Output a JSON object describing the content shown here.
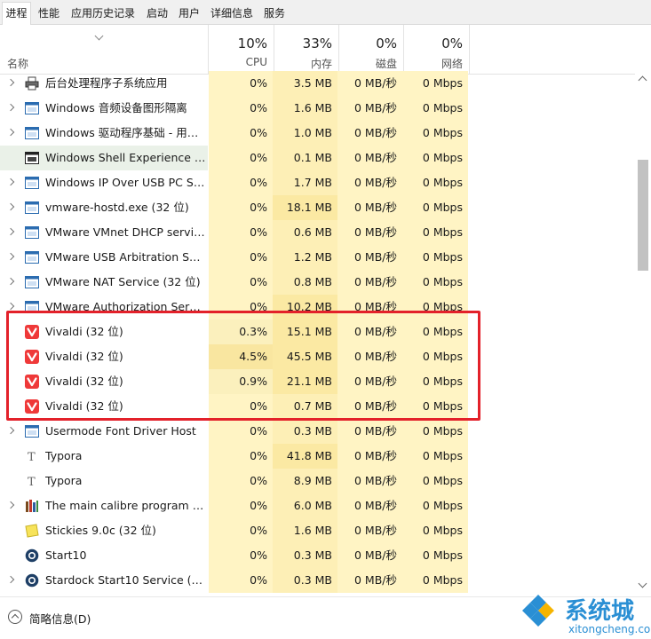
{
  "tabs": [
    "进程",
    "性能",
    "应用历史记录",
    "启动",
    "用户",
    "详细信息",
    "服务"
  ],
  "header": {
    "name_label": "名称",
    "cpu": {
      "pct": "10%",
      "label": "CPU"
    },
    "mem": {
      "pct": "33%",
      "label": "内存"
    },
    "disk": {
      "pct": "0%",
      "label": "磁盘"
    },
    "net": {
      "pct": "0%",
      "label": "网络"
    }
  },
  "rows": [
    {
      "name": "后台处理程序子系统应用",
      "cpu": "0%",
      "mem": "3.5 MB",
      "disk": "0 MB/秒",
      "net": "0 Mbps",
      "icon": "printer-icon"
    },
    {
      "name": "Windows 音频设备图形隔离",
      "cpu": "0%",
      "mem": "1.6 MB",
      "disk": "0 MB/秒",
      "net": "0 Mbps",
      "icon": "window-app-icon"
    },
    {
      "name": "Windows 驱动程序基础 - 用户...",
      "cpu": "0%",
      "mem": "1.0 MB",
      "disk": "0 MB/秒",
      "net": "0 Mbps",
      "icon": "window-app-icon"
    },
    {
      "name": "Windows Shell Experience H...",
      "cpu": "0%",
      "mem": "0.1 MB",
      "disk": "0 MB/秒",
      "net": "0 Mbps",
      "icon": "shell-window-icon"
    },
    {
      "name": "Windows IP Over USB PC Se...",
      "cpu": "0%",
      "mem": "1.7 MB",
      "disk": "0 MB/秒",
      "net": "0 Mbps",
      "icon": "window-app-icon"
    },
    {
      "name": "vmware-hostd.exe (32 位)",
      "cpu": "0%",
      "mem": "18.1 MB",
      "disk": "0 MB/秒",
      "net": "0 Mbps",
      "icon": "window-app-icon"
    },
    {
      "name": "VMware VMnet DHCP servic...",
      "cpu": "0%",
      "mem": "0.6 MB",
      "disk": "0 MB/秒",
      "net": "0 Mbps",
      "icon": "window-app-icon"
    },
    {
      "name": "VMware USB Arbitration Ser...",
      "cpu": "0%",
      "mem": "1.2 MB",
      "disk": "0 MB/秒",
      "net": "0 Mbps",
      "icon": "window-app-icon"
    },
    {
      "name": "VMware NAT Service (32 位)",
      "cpu": "0%",
      "mem": "0.8 MB",
      "disk": "0 MB/秒",
      "net": "0 Mbps",
      "icon": "window-app-icon"
    },
    {
      "name": "VMware Authorization Servic...",
      "cpu": "0%",
      "mem": "10.2 MB",
      "disk": "0 MB/秒",
      "net": "0 Mbps",
      "icon": "window-app-icon"
    },
    {
      "name": "Vivaldi (32 位)",
      "cpu": "0.3%",
      "mem": "15.1 MB",
      "disk": "0 MB/秒",
      "net": "0 Mbps",
      "icon": "vivaldi-icon"
    },
    {
      "name": "Vivaldi (32 位)",
      "cpu": "4.5%",
      "mem": "45.5 MB",
      "disk": "0 MB/秒",
      "net": "0 Mbps",
      "icon": "vivaldi-icon"
    },
    {
      "name": "Vivaldi (32 位)",
      "cpu": "0.9%",
      "mem": "21.1 MB",
      "disk": "0 MB/秒",
      "net": "0 Mbps",
      "icon": "vivaldi-icon"
    },
    {
      "name": "Vivaldi (32 位)",
      "cpu": "0%",
      "mem": "0.7 MB",
      "disk": "0 MB/秒",
      "net": "0 Mbps",
      "icon": "vivaldi-icon"
    },
    {
      "name": "Usermode Font Driver Host",
      "cpu": "0%",
      "mem": "0.3 MB",
      "disk": "0 MB/秒",
      "net": "0 Mbps",
      "icon": "window-app-icon"
    },
    {
      "name": "Typora",
      "cpu": "0%",
      "mem": "41.8 MB",
      "disk": "0 MB/秒",
      "net": "0 Mbps",
      "icon": "typora-icon"
    },
    {
      "name": "Typora",
      "cpu": "0%",
      "mem": "8.9 MB",
      "disk": "0 MB/秒",
      "net": "0 Mbps",
      "icon": "typora-icon"
    },
    {
      "name": "The main calibre program (3...",
      "cpu": "0%",
      "mem": "6.0 MB",
      "disk": "0 MB/秒",
      "net": "0 Mbps",
      "icon": "calibre-icon"
    },
    {
      "name": "Stickies 9.0c (32 位)",
      "cpu": "0%",
      "mem": "1.6 MB",
      "disk": "0 MB/秒",
      "net": "0 Mbps",
      "icon": "stickies-icon"
    },
    {
      "name": "Start10",
      "cpu": "0%",
      "mem": "0.3 MB",
      "disk": "0 MB/秒",
      "net": "0 Mbps",
      "icon": "start10-icon"
    },
    {
      "name": "Stardock Start10 Service (32 ...",
      "cpu": "0%",
      "mem": "0.3 MB",
      "disk": "0 MB/秒",
      "net": "0 Mbps",
      "icon": "start10-icon"
    }
  ],
  "footer": {
    "fewer_details": "简略信息(D)"
  },
  "watermark": {
    "text": "系统城",
    "url": "xitongcheng.com"
  },
  "colors": {
    "cell_light": "#fff4c4",
    "cell_mid": "#f9eba7",
    "cell_strong": "#fbe9a3",
    "highlight_box": "#e3212a",
    "watermark": "#2a8fd4"
  }
}
